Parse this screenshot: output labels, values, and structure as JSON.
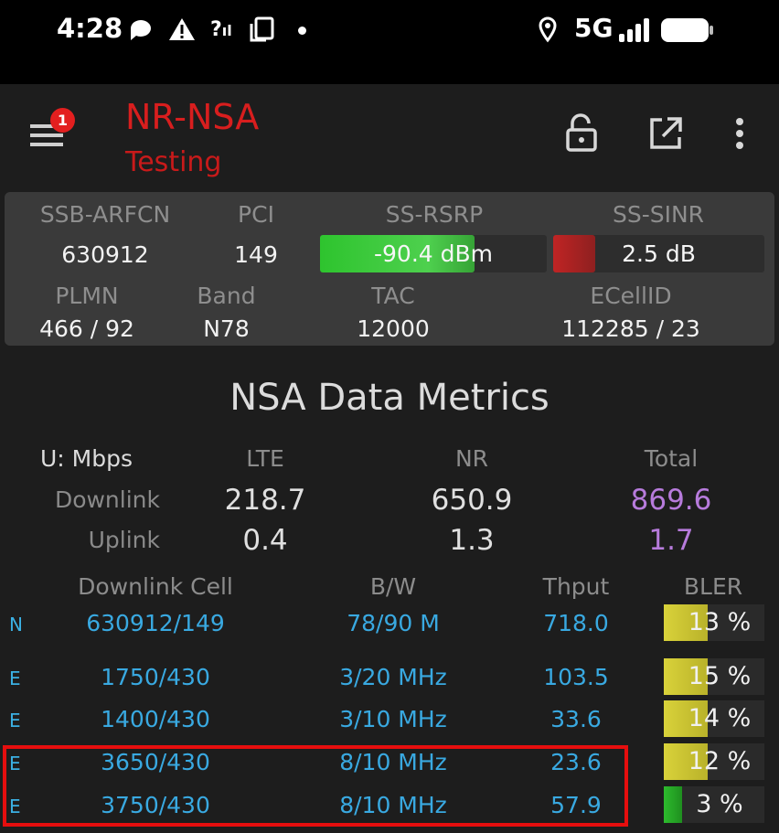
{
  "status_bar": {
    "time": "4:28",
    "network": "5G",
    "icons": [
      "chat-icon",
      "warning-icon",
      "signal-unknown-icon",
      "screenshot-icon",
      "dot-icon",
      "location-icon",
      "signal-bars-icon",
      "battery-icon"
    ]
  },
  "app_bar": {
    "title": "NR-NSA",
    "subtitle": "Testing",
    "menu_badge": "1",
    "accent": "#d81e1e"
  },
  "cell_info": {
    "labels": {
      "ssb_arfcn": "SSB-ARFCN",
      "pci": "PCI",
      "ss_rsrp": "SS-RSRP",
      "ss_sinr": "SS-SINR",
      "plmn": "PLMN",
      "band": "Band",
      "tac": "TAC",
      "ecellid": "ECellID"
    },
    "values": {
      "ssb_arfcn": "630912",
      "pci": "149",
      "ss_rsrp": "-90.4 dBm",
      "ss_sinr": "2.5 dB",
      "plmn": "466 / 92",
      "band": "N78",
      "tac": "12000",
      "ecellid": "112285 / 23"
    },
    "rsrp_fill": 0.68,
    "sinr_fill": 0.2
  },
  "metrics": {
    "heading": "NSA Data Metrics",
    "unit_label": "U: Mbps",
    "col_lte": "LTE",
    "col_nr": "NR",
    "col_total": "Total",
    "rows": [
      {
        "label": "Downlink",
        "lte": "218.7",
        "nr": "650.9",
        "total": "869.6"
      },
      {
        "label": "Uplink",
        "lte": "0.4",
        "nr": "1.3",
        "total": "1.7"
      }
    ]
  },
  "cells": {
    "headers": {
      "cell": "Downlink Cell",
      "bw": "B/W",
      "thput": "Thput",
      "bler": "BLER"
    },
    "rows": [
      {
        "type": "N",
        "cell": "630912/149",
        "bw": "78/90 M",
        "thput": "718.0",
        "bler": "13 %",
        "bler_value": 0.13
      },
      {
        "type": "E",
        "cell": "1750/430",
        "bw": "3/20 MHz",
        "thput": "103.5",
        "bler": "15 %",
        "bler_value": 0.15
      },
      {
        "type": "E",
        "cell": "1400/430",
        "bw": "3/10 MHz",
        "thput": "33.6",
        "bler": "14 %",
        "bler_value": 0.14
      },
      {
        "type": "E",
        "cell": "3650/430",
        "bw": "8/10 MHz",
        "thput": "23.6",
        "bler": "12 %",
        "bler_value": 0.12
      },
      {
        "type": "E",
        "cell": "3750/430",
        "bw": "8/10 MHz",
        "thput": "57.9",
        "bler": "3 %",
        "bler_value": 0.03
      }
    ]
  }
}
